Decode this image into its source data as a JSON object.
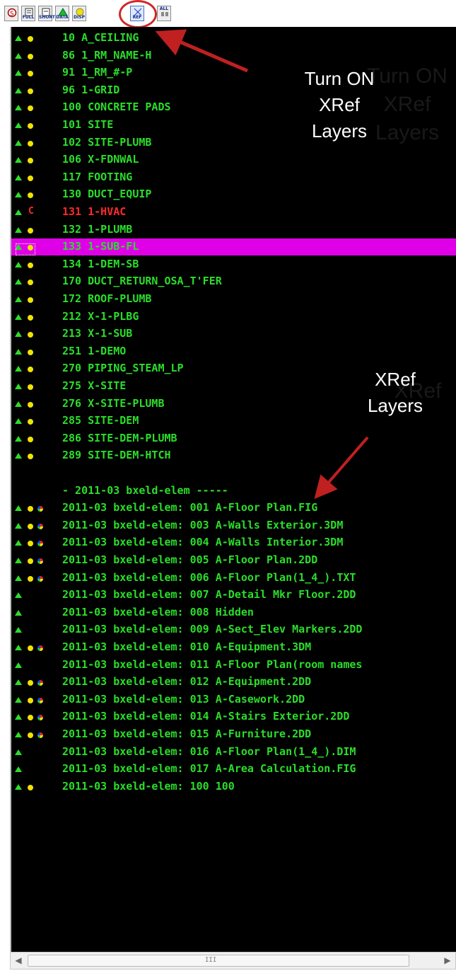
{
  "toolbar": {
    "buttons": [
      {
        "icon": "search-settings-icon",
        "label": ""
      },
      {
        "icon": "full-list-icon",
        "label": "FULL"
      },
      {
        "icon": "short-list-icon",
        "label": "SHORT"
      },
      {
        "icon": "data-triangle-icon",
        "label": "DATA"
      },
      {
        "icon": "display-bulb-icon",
        "label": "DISP"
      },
      {
        "icon": "xref-icon",
        "label": "REF"
      },
      {
        "icon": "all-layers-icon",
        "label": "ALL"
      }
    ]
  },
  "annotations": {
    "turn_on": [
      "Turn ON",
      "XRef",
      "Layers"
    ],
    "xref_layers": [
      "XRef",
      "Layers"
    ]
  },
  "layers": [
    {
      "status": "tri-yellow",
      "name": "10 A_CEILING"
    },
    {
      "status": "tri-yellow",
      "name": "86 1_RM_NAME-H"
    },
    {
      "status": "tri-yellow",
      "name": "91 1_RM_#-P"
    },
    {
      "status": "tri-yellow",
      "name": "96 1-GRID"
    },
    {
      "status": "tri-yellow",
      "name": "100 CONCRETE PADS"
    },
    {
      "status": "tri-yellow",
      "name": "101 SITE"
    },
    {
      "status": "tri-yellow",
      "name": "102 SITE-PLUMB"
    },
    {
      "status": "tri-yellow",
      "name": "106 X-FDNWAL"
    },
    {
      "status": "tri-yellow",
      "name": "117 FOOTING"
    },
    {
      "status": "tri-yellow",
      "name": "130 DUCT_EQUIP"
    },
    {
      "status": "tri-c",
      "name": "131 1-HVAC",
      "color": "red"
    },
    {
      "status": "tri-yellow",
      "name": "132 1-PLUMB"
    },
    {
      "status": "tri-yellow",
      "name": "133 1-SUB-FL",
      "selected": true
    },
    {
      "status": "tri-yellow",
      "name": "134 1-DEM-SB"
    },
    {
      "status": "tri-yellow",
      "name": "170 DUCT_RETURN_OSA_T'FER"
    },
    {
      "status": "tri-yellow",
      "name": "172 ROOF-PLUMB"
    },
    {
      "status": "tri-yellow",
      "name": "212 X-1-PLBG"
    },
    {
      "status": "tri-yellow",
      "name": "213 X-1-SUB"
    },
    {
      "status": "tri-yellow",
      "name": "251 1-DEMO"
    },
    {
      "status": "tri-yellow",
      "name": "270 PIPING_STEAM_LP"
    },
    {
      "status": "tri-yellow",
      "name": "275 X-SITE"
    },
    {
      "status": "tri-yellow",
      "name": "276 X-SITE-PLUMB"
    },
    {
      "status": "tri-yellow",
      "name": "285 SITE-DEM"
    },
    {
      "status": "tri-yellow",
      "name": "286 SITE-DEM-PLUMB"
    },
    {
      "status": "tri-yellow",
      "name": "289 SITE-DEM-HTCH"
    },
    {
      "status": "none",
      "name": ""
    },
    {
      "status": "none",
      "name": "- 2011-03 bxeld-elem -----"
    },
    {
      "status": "tri-yellow-multi",
      "name": "2011-03 bxeld-elem: 001 A-Floor Plan.FIG"
    },
    {
      "status": "tri-yellow-multi",
      "name": "2011-03 bxeld-elem: 003 A-Walls Exterior.3DM"
    },
    {
      "status": "tri-yellow-multi",
      "name": "2011-03 bxeld-elem: 004 A-Walls Interior.3DM"
    },
    {
      "status": "tri-yellow-multi",
      "name": "2011-03 bxeld-elem: 005 A-Floor Plan.2DD"
    },
    {
      "status": "tri-yellow-multi",
      "name": "2011-03 bxeld-elem: 006 A-Floor Plan(1_4_).TXT"
    },
    {
      "status": "tri",
      "name": "2011-03 bxeld-elem: 007 A-Detail Mkr Floor.2DD"
    },
    {
      "status": "tri",
      "name": "2011-03 bxeld-elem: 008 Hidden"
    },
    {
      "status": "tri",
      "name": "2011-03 bxeld-elem: 009 A-Sect_Elev Markers.2DD"
    },
    {
      "status": "tri-yellow-multi",
      "name": "2011-03 bxeld-elem: 010 A-Equipment.3DM"
    },
    {
      "status": "tri",
      "name": "2011-03 bxeld-elem: 011 A-Floor Plan(room names"
    },
    {
      "status": "tri-yellow-multi",
      "name": "2011-03 bxeld-elem: 012 A-Equipment.2DD"
    },
    {
      "status": "tri-yellow-multi",
      "name": "2011-03 bxeld-elem: 013 A-Casework.2DD"
    },
    {
      "status": "tri-yellow-multi",
      "name": "2011-03 bxeld-elem: 014 A-Stairs Exterior.2DD"
    },
    {
      "status": "tri-yellow-multi",
      "name": "2011-03 bxeld-elem: 015 A-Furniture.2DD"
    },
    {
      "status": "tri",
      "name": "2011-03 bxeld-elem: 016 A-Floor Plan(1_4_).DIM"
    },
    {
      "status": "tri",
      "name": "2011-03 bxeld-elem: 017 A-Area Calculation.FIG"
    },
    {
      "status": "tri-yellow",
      "name": "2011-03 bxeld-elem: 100 100"
    }
  ],
  "scrollbar": {
    "grip": "III",
    "position": 0.0
  }
}
